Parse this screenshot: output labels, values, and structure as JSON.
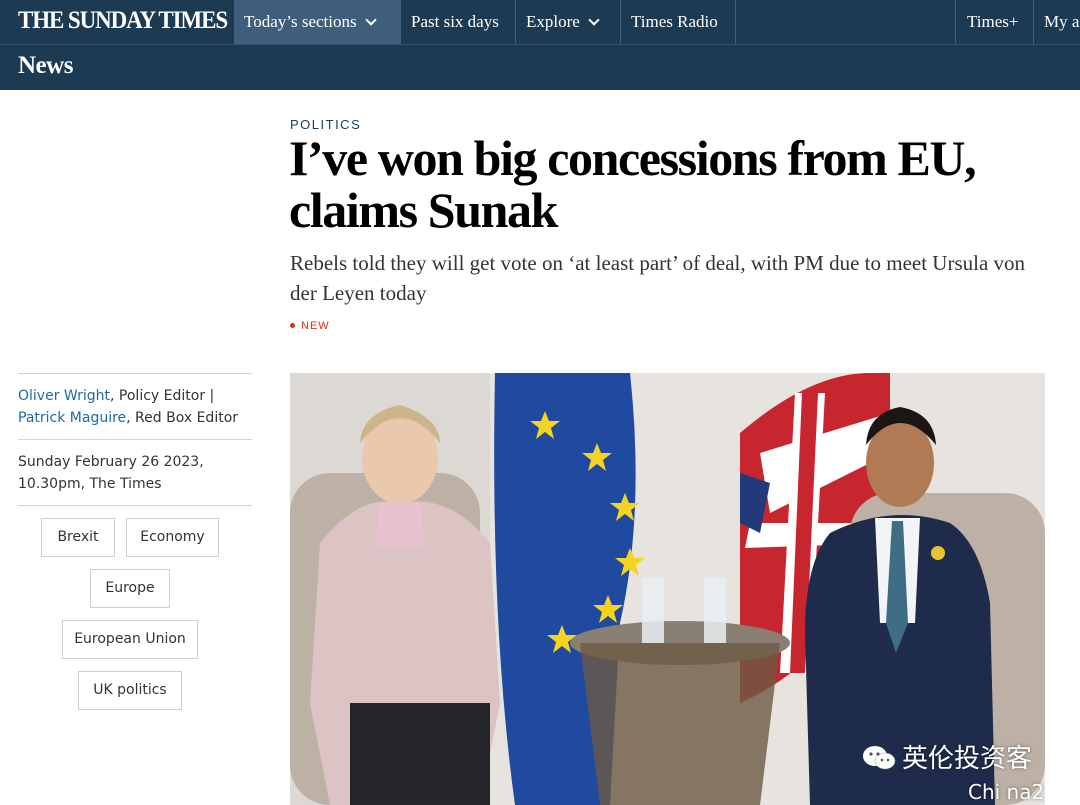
{
  "masthead": {
    "logo": "THE SUNDAY TIMES",
    "nav": [
      {
        "label": "Today’s sections",
        "dropdown": true,
        "active": true
      },
      {
        "label": "Past six days",
        "dropdown": false
      },
      {
        "label": "Explore",
        "dropdown": true
      },
      {
        "label": "Times Radio",
        "dropdown": false
      }
    ],
    "right": [
      {
        "label": "Times+"
      },
      {
        "label": "My a"
      }
    ]
  },
  "section_bar": {
    "title": "News"
  },
  "article": {
    "kicker": "POLITICS",
    "headline_line1": "I’ve won big concessions from EU,",
    "headline_line2": "claims Sunak",
    "standfirst": "Rebels told they will get vote on ‘at least part’ of deal, with PM due to meet Ursula von der Leyen today",
    "badge": "NEW"
  },
  "byline": {
    "author1": "Oliver Wright",
    "role1": ", Policy Editor | ",
    "author2": "Patrick Maguire",
    "role2": ", Red Box Editor"
  },
  "dateline": "Sunday February 26 2023, 10.30pm, The Times",
  "tags": [
    "Brexit",
    "Economy",
    "Europe",
    "European Union",
    "UK politics"
  ],
  "watermark": {
    "text": "英伦投资客",
    "subtext": "Chi na2"
  },
  "colors": {
    "navy": "#1d3a53",
    "nav_active": "#3e5e7b",
    "link": "#1d6aa3",
    "new_red": "#d0341e"
  }
}
